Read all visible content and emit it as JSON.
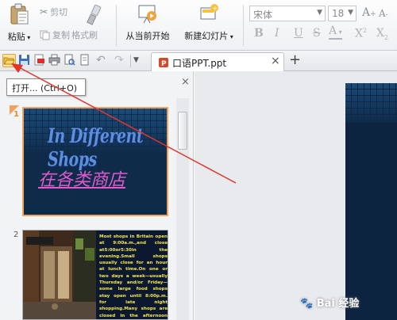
{
  "ribbon": {
    "paste_label": "粘贴",
    "cut_label": "剪切",
    "copy_label": "复制",
    "format_painter_label": "格式刷",
    "from_current_label": "从当前开始",
    "new_slide_label": "新建幻灯片",
    "font_name": "宋体",
    "font_size": "18",
    "grow_font_label": "A",
    "shrink_font_label": "A",
    "bold_label": "B",
    "italic_label": "I",
    "underline_label": "U",
    "strike_label": "S",
    "font_color_label": "A",
    "superscript_label": "X",
    "subscript_label": "X",
    "superscript_mark": "2",
    "subscript_mark": "2"
  },
  "tabs": {
    "doc_tab_title": "口语PPT.ppt",
    "close_glyph": "×",
    "add_glyph": "+"
  },
  "tooltip": {
    "text": "打开... (Ctrl+O)"
  },
  "panel": {
    "close_glyph": "×",
    "slide1_number": "1",
    "slide2_number": "2"
  },
  "slide1": {
    "title_en": "In Different Shops",
    "title_cn": "在各类商店"
  },
  "slide2": {
    "body_text": "Most shops in Britain open at 9:00a.m.,and close at5:00or5:30in the evening.Small shops usually close for an hour at lunch time.On one or two days a week—usually Thursday and/or Friday—some large food shops stay open until 8:00p.m. for late night shopping.Many shops are closed in the afternoon one day a week. the day is usually Wednesday or"
  },
  "watermark": {
    "text": "Bai 经验"
  },
  "colors": {
    "accent_orange": "#f0a35e",
    "arrow_red": "#e0352b",
    "slide_bg": "#0f2b4a",
    "title_en_color": "#5b8fe0",
    "title_cn_color": "#e05acb",
    "slide2_text": "#f4e84a"
  }
}
